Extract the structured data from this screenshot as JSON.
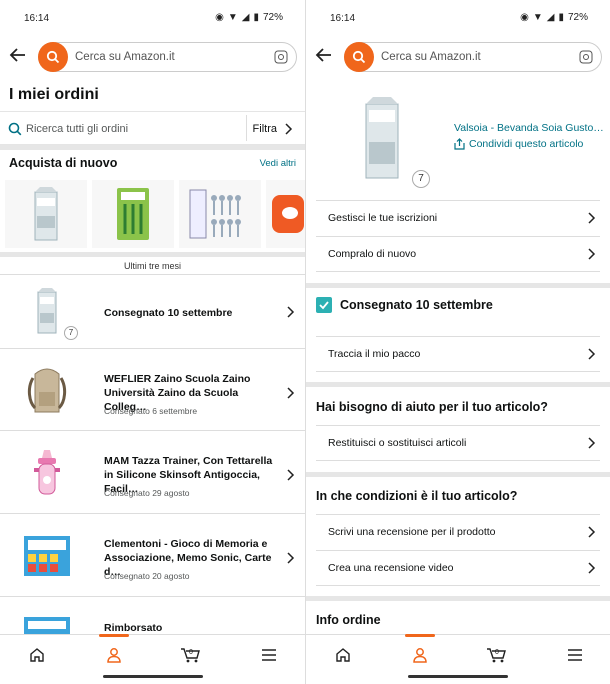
{
  "status": {
    "time": "16:14",
    "battery": "72%"
  },
  "search": {
    "placeholder": "Cerca su Amazon.it"
  },
  "left": {
    "title": "I miei ordini",
    "orders_search_placeholder": "Ricerca tutti gli ordini",
    "filter_label": "Filtra",
    "buy_again_title": "Acquista di nuovo",
    "see_more": "Vedi altri",
    "period": "Ultimi tre mesi",
    "orders": [
      {
        "name": "Consegnato 10 settembre",
        "date": "",
        "qty": "7"
      },
      {
        "name": "WEFLIER Zaino Scuola Zaino Università Zaino da Scuola Colleg…",
        "date": "Consegnato 6 settembre"
      },
      {
        "name": "MAM Tazza Trainer, Con Tettarella in Silicone Skinsoft Antigoccia, Facil…",
        "date": "Consegnato 29 agosto"
      },
      {
        "name": "Clementoni - Gioco di Memoria e Associazione, Memo Sonic, Carte d…",
        "date": "Consegnato 20 agosto"
      },
      {
        "name": "Rimborsato",
        "date": ""
      }
    ]
  },
  "right": {
    "product_title": "Valsoia - Bevanda Soia Gusto…",
    "share_label": "Condividi questo articolo",
    "qty": "7",
    "rows_top": [
      "Gestisci le tue iscrizioni",
      "Compralo di nuovo"
    ],
    "delivered": "Consegnato 10 settembre",
    "track": "Traccia il mio pacco",
    "help_title": "Hai bisogno di aiuto per il tuo articolo?",
    "return": "Restituisci o sostituisci articoli",
    "condition_title": "In che condizioni è il tuo articolo?",
    "review": "Scrivi una recensione per il prodotto",
    "video_review": "Crea una recensione video",
    "order_info": "Info ordine"
  },
  "nav": {
    "cart_count": "0"
  },
  "colors": {
    "accent": "#f0661b",
    "link": "#007185",
    "check": "#2cb0b3"
  }
}
